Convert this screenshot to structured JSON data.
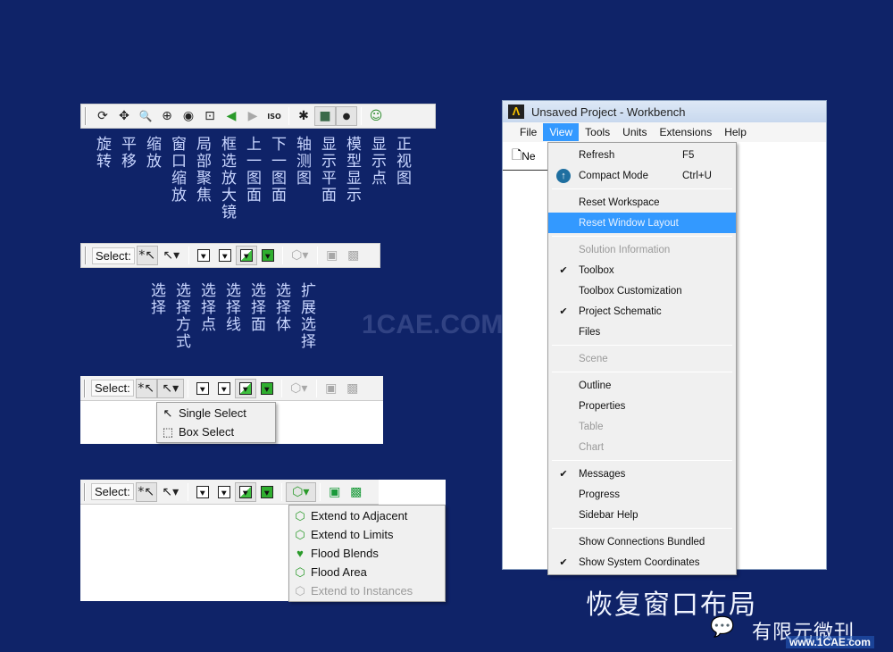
{
  "toolbar1": {
    "buttons": [
      {
        "icon": "rotate-icon",
        "glyph": "⟳"
      },
      {
        "icon": "pan-icon",
        "glyph": "✥"
      },
      {
        "icon": "zoom-icon",
        "glyph": "🔍"
      },
      {
        "icon": "box-zoom-icon",
        "glyph": "⊕"
      },
      {
        "icon": "zoom-to-fit-icon",
        "glyph": "◉"
      },
      {
        "icon": "magnifier-icon",
        "glyph": "⊡"
      },
      {
        "icon": "previous-view-icon",
        "glyph": "◀"
      },
      {
        "icon": "next-view-icon",
        "glyph": "▶"
      },
      {
        "icon": "iso-view-icon",
        "glyph": "ISO"
      },
      {
        "icon": "display-plane-icon",
        "glyph": "✱"
      },
      {
        "icon": "model-display-icon",
        "glyph": "■"
      },
      {
        "icon": "display-points-icon",
        "glyph": "●"
      },
      {
        "icon": "look-at-icon",
        "glyph": "☺"
      }
    ],
    "labels": [
      "旋转",
      "平移",
      "缩放",
      "窗口缩放",
      "局部聚焦",
      "框选放大镜",
      "上一图面",
      "下一图面",
      "轴测图",
      "显示平面",
      "模型显示",
      "显示点",
      "正视图"
    ]
  },
  "toolbar2": {
    "select_label": "Select:",
    "labels": [
      "选择",
      "选择方式",
      "选择点",
      "选择线",
      "选择面",
      "选择体",
      "扩展选择"
    ]
  },
  "toolbar3": {
    "select_label": "Select:",
    "dropdown": [
      "Single Select",
      "Box Select"
    ]
  },
  "toolbar4": {
    "select_label": "Select:",
    "dropdown": [
      {
        "label": "Extend to Adjacent",
        "disabled": false
      },
      {
        "label": "Extend to Limits",
        "disabled": false
      },
      {
        "label": "Flood Blends",
        "disabled": false
      },
      {
        "label": "Flood Area",
        "disabled": false
      },
      {
        "label": "Extend to Instances",
        "disabled": true
      }
    ]
  },
  "watermark": "1CAE.COM",
  "workbench": {
    "title": "Unsaved Project - Workbench",
    "menubar": [
      "File",
      "View",
      "Tools",
      "Units",
      "Extensions",
      "Help"
    ],
    "active_menu": "View",
    "toolbar_new": "Ne",
    "view_menu": {
      "refresh": {
        "label": "Refresh",
        "shortcut": "F5"
      },
      "compact": {
        "label": "Compact Mode",
        "shortcut": "Ctrl+U"
      },
      "reset_workspace": "Reset Workspace",
      "reset_window_layout": "Reset Window Layout",
      "solution_information": "Solution Information",
      "toolbox": "Toolbox",
      "toolbox_customization": "Toolbox Customization",
      "project_schematic": "Project Schematic",
      "files": "Files",
      "scene": "Scene",
      "outline": "Outline",
      "properties": "Properties",
      "table": "Table",
      "chart": "Chart",
      "messages": "Messages",
      "progress": "Progress",
      "sidebar_help": "Sidebar Help",
      "show_connections_bundled": "Show Connections Bundled",
      "show_system_coordinates": "Show System Coordinates",
      "check": "✔"
    }
  },
  "caption": "恢复窗口布局",
  "footer": {
    "brand": "有限元微刊",
    "site": "www.1CAE.com"
  }
}
